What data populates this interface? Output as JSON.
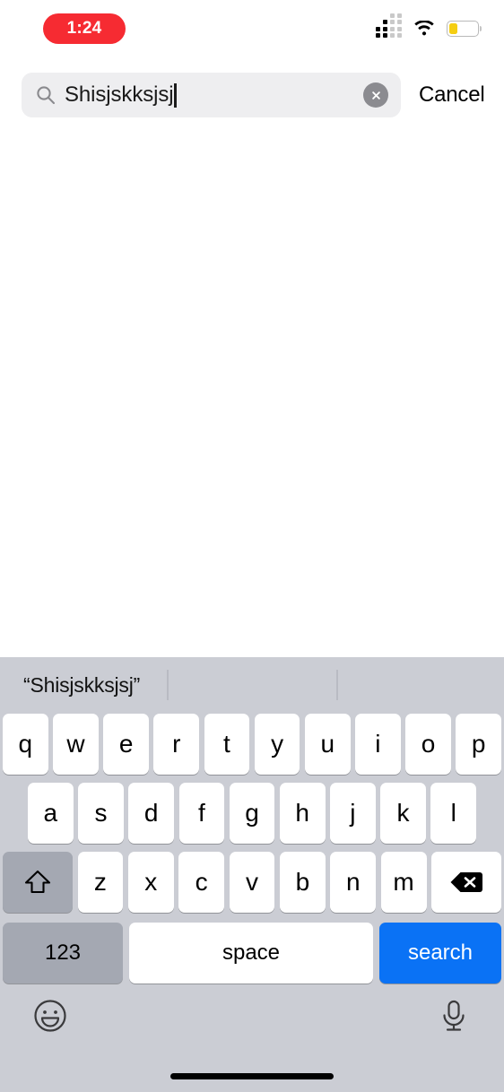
{
  "status_bar": {
    "recording_time": "1:24",
    "recording_pill_color": "#f62b32",
    "cellular_icon": "cellular-signal-icon",
    "wifi_icon": "wifi-icon",
    "battery_icon": "battery-icon",
    "battery_level_percent": 30,
    "battery_color": "#f5ce12"
  },
  "search": {
    "value": "Shisjskksjsj",
    "placeholder": "Search",
    "search_icon": "search-icon",
    "clear_icon": "clear-icon",
    "cancel_label": "Cancel",
    "field_background": "#eeeef0"
  },
  "keyboard": {
    "background": "#cbcdd4",
    "suggestion": "“Shisjskksjsj”",
    "row1": [
      "q",
      "w",
      "e",
      "r",
      "t",
      "y",
      "u",
      "i",
      "o",
      "p"
    ],
    "row2": [
      "a",
      "s",
      "d",
      "f",
      "g",
      "h",
      "j",
      "k",
      "l"
    ],
    "row3": [
      "z",
      "x",
      "c",
      "v",
      "b",
      "n",
      "m"
    ],
    "shift_icon": "shift-icon",
    "delete_icon": "backspace-icon",
    "numbers_label": "123",
    "space_label": "space",
    "return_label": "search",
    "return_key_color": "#0a72f5",
    "emoji_icon": "emoji-icon",
    "dictation_icon": "microphone-icon"
  },
  "home_indicator": "home-indicator"
}
